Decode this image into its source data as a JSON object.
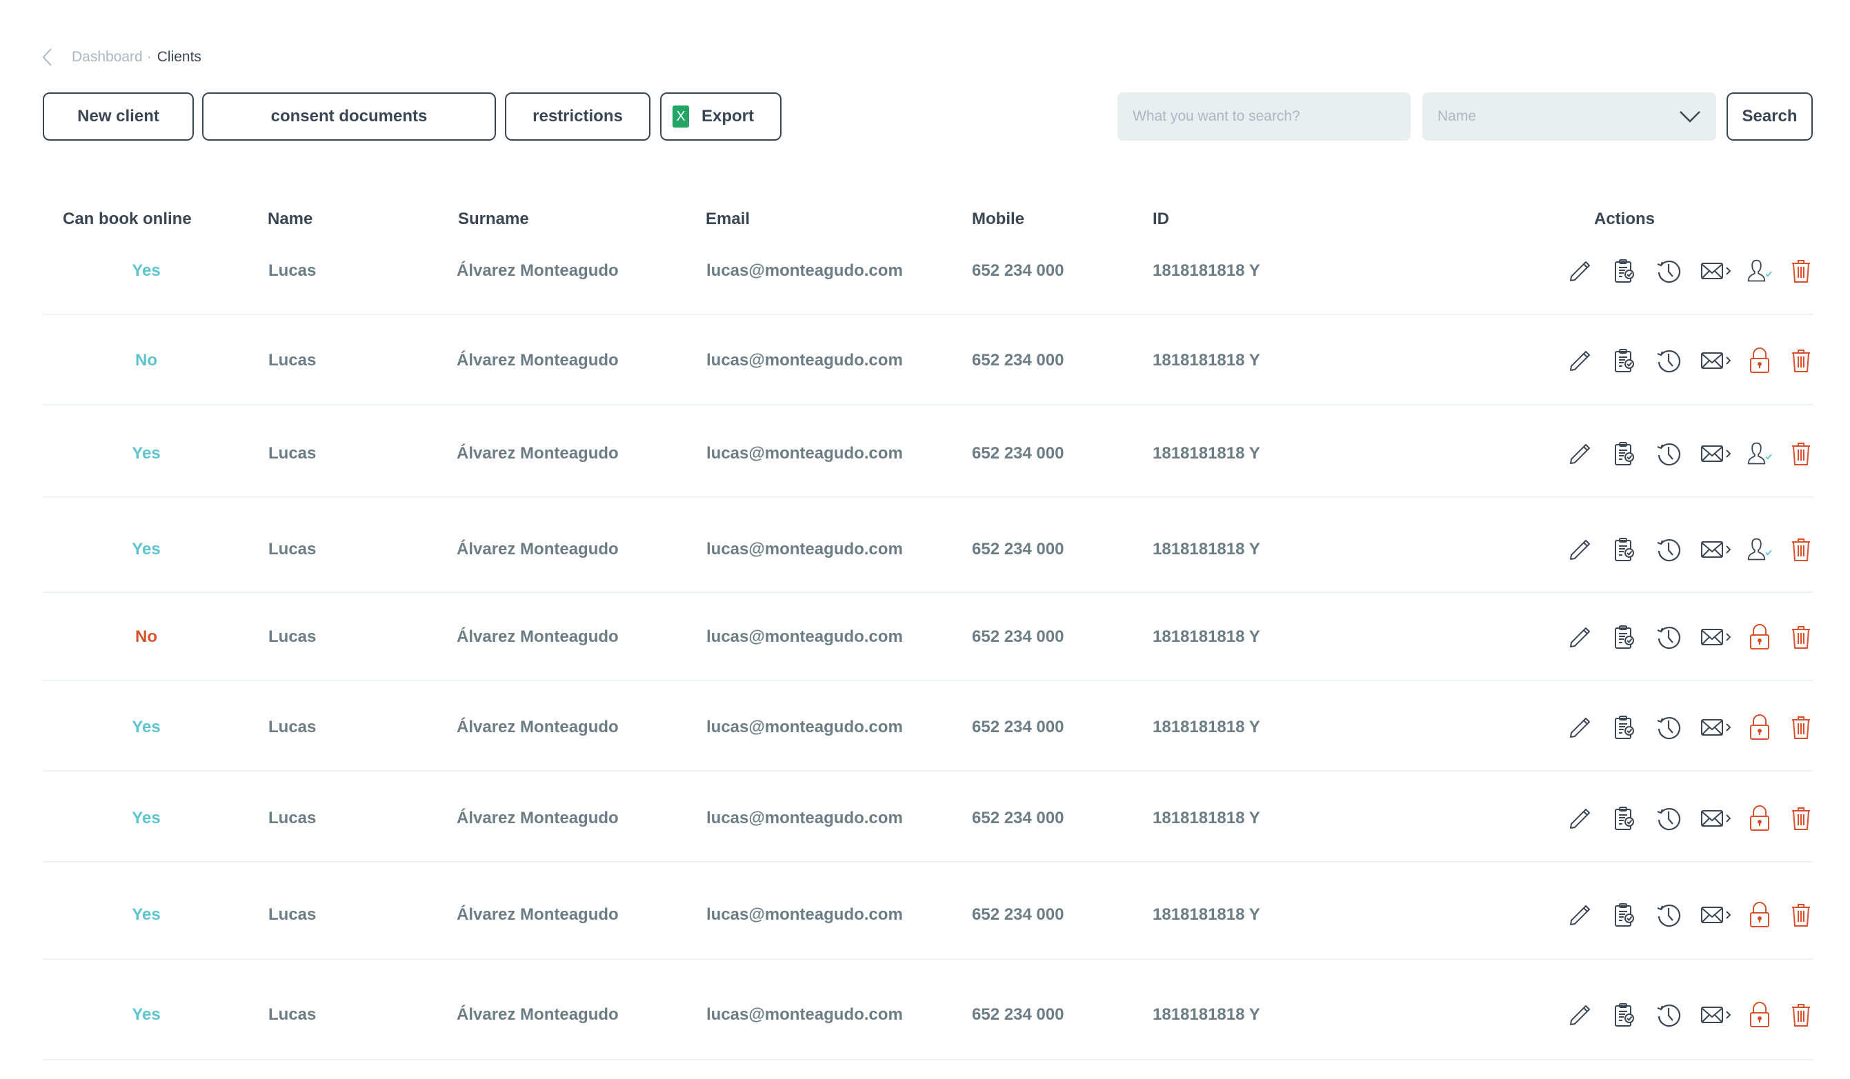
{
  "breadcrumb": {
    "back_icon": "chevron-left-icon",
    "parent": "Dashboard",
    "separator": "·",
    "current": "Clients"
  },
  "toolbar": {
    "new_client_label": "New client",
    "consent_documents_label": "consent documents",
    "restrictions_label": "restrictions",
    "export_label": "Export",
    "export_icon": "excel-icon",
    "export_icon_glyph": "X",
    "search_placeholder": "What you want to search?",
    "search_value": "",
    "search_field_selected": "Name",
    "search_button_label": "Search"
  },
  "colors": {
    "accent_teal": "#5ec5cf",
    "danger": "#d9512c",
    "text_dark": "#3b4654",
    "text_muted": "#6c7d86",
    "excel_green": "#23a566",
    "input_bg": "#e9eef1"
  },
  "table": {
    "columns": [
      "Can book online",
      "Name",
      "Surname",
      "Email",
      "Mobile",
      "ID",
      "Actions"
    ],
    "rows": [
      {
        "can_book": "Yes",
        "can_book_status": "yes",
        "name": "Lucas",
        "surname": "Álvarez Monteagudo",
        "email": "lucas@monteagudo.com",
        "mobile": "652 234 000",
        "id": "1818181818 Y",
        "access_icon": "user-check-icon"
      },
      {
        "can_book": "No",
        "can_book_status": "no-ok",
        "name": "Lucas",
        "surname": "Álvarez Monteagudo",
        "email": "lucas@monteagudo.com",
        "mobile": "652 234 000",
        "id": "1818181818 Y",
        "access_icon": "lock-icon"
      },
      {
        "can_book": "Yes",
        "can_book_status": "yes",
        "name": "Lucas",
        "surname": "Álvarez Monteagudo",
        "email": "lucas@monteagudo.com",
        "mobile": "652 234 000",
        "id": "1818181818 Y",
        "access_icon": "user-check-icon"
      },
      {
        "can_book": "Yes",
        "can_book_status": "yes",
        "name": "Lucas",
        "surname": "Álvarez Monteagudo",
        "email": "lucas@monteagudo.com",
        "mobile": "652 234 000",
        "id": "1818181818 Y",
        "access_icon": "user-check-icon"
      },
      {
        "can_book": "No",
        "can_book_status": "no-bad",
        "name": "Lucas",
        "surname": "Álvarez Monteagudo",
        "email": "lucas@monteagudo.com",
        "mobile": "652 234 000",
        "id": "1818181818 Y",
        "access_icon": "lock-icon"
      },
      {
        "can_book": "Yes",
        "can_book_status": "yes",
        "name": "Lucas",
        "surname": "Álvarez Monteagudo",
        "email": "lucas@monteagudo.com",
        "mobile": "652 234 000",
        "id": "1818181818 Y",
        "access_icon": "lock-icon"
      },
      {
        "can_book": "Yes",
        "can_book_status": "yes",
        "name": "Lucas",
        "surname": "Álvarez Monteagudo",
        "email": "lucas@monteagudo.com",
        "mobile": "652 234 000",
        "id": "1818181818 Y",
        "access_icon": "lock-icon"
      },
      {
        "can_book": "Yes",
        "can_book_status": "yes",
        "name": "Lucas",
        "surname": "Álvarez Monteagudo",
        "email": "lucas@monteagudo.com",
        "mobile": "652 234 000",
        "id": "1818181818 Y",
        "access_icon": "lock-icon"
      },
      {
        "can_book": "Yes",
        "can_book_status": "yes",
        "name": "Lucas",
        "surname": "Álvarez Monteagudo",
        "email": "lucas@monteagudo.com",
        "mobile": "652 234 000",
        "id": "1818181818 Y",
        "access_icon": "lock-icon"
      }
    ],
    "row_action_icons": [
      "pencil-icon",
      "clipboard-check-icon",
      "history-icon",
      "mail-send-icon",
      "access-icon",
      "trash-icon"
    ]
  }
}
